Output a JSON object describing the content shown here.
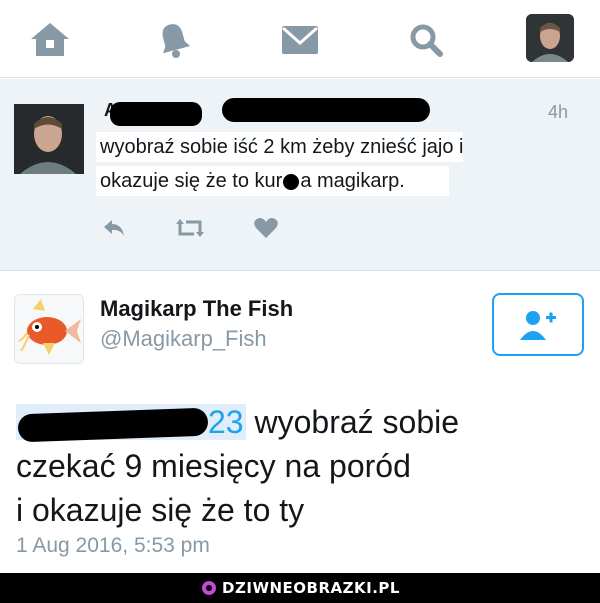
{
  "nav": {
    "items": [
      "home-icon",
      "bell-icon",
      "mail-icon",
      "search-icon",
      "profile-avatar"
    ]
  },
  "tweet1": {
    "time": "4h",
    "line1": "wyobraź sobie iść 2 km żeby znieść jajo i",
    "line2_pre": "okazuje się że to kur",
    "line2_post": "a magikarp."
  },
  "tweet2": {
    "name": "Magikarp The Fish",
    "handle": "@Magikarp_Fish",
    "mention_suffix": "23",
    "text_after_mention": " wyobraź sobie",
    "line2": "czekać 9 miesięcy na poród",
    "line3": "i okazuje się że to ty",
    "date": "1 Aug 2016, 5:53 pm"
  },
  "footer": {
    "brand": "DZIWNEOBRAZKI.PL"
  },
  "colors": {
    "accent": "#1da1f2",
    "icon_gray": "#8899a6",
    "tweet_bg": "#eef3f7",
    "text": "#14171a"
  }
}
